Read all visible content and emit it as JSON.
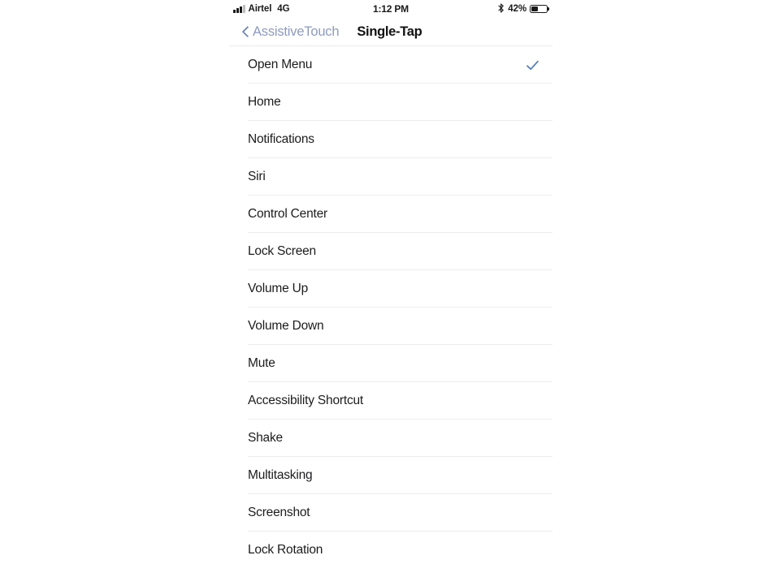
{
  "status_bar": {
    "carrier": "Airtel",
    "network": "4G",
    "time": "1:12 PM",
    "battery_percent": "42%",
    "battery_level": 42,
    "signal_bars_filled": 3,
    "signal_bars_total": 4,
    "bluetooth_icon": "bluetooth-icon",
    "battery_icon": "battery-icon"
  },
  "nav_bar": {
    "back_label": "AssistiveTouch",
    "back_icon": "chevron-left-icon",
    "title": "Single-Tap",
    "back_tint": "#8e9bbd"
  },
  "list": {
    "selected": "Open Menu",
    "checkmark_icon": "checkmark-icon",
    "checkmark_color": "#4d7cb0",
    "rows": [
      {
        "label": "Open Menu",
        "checked": true
      },
      {
        "label": "Home",
        "checked": false
      },
      {
        "label": "Notifications",
        "checked": false
      },
      {
        "label": "Siri",
        "checked": false
      },
      {
        "label": "Control Center",
        "checked": false
      },
      {
        "label": "Lock Screen",
        "checked": false
      },
      {
        "label": "Volume Up",
        "checked": false
      },
      {
        "label": "Volume Down",
        "checked": false
      },
      {
        "label": "Mute",
        "checked": false
      },
      {
        "label": "Accessibility Shortcut",
        "checked": false
      },
      {
        "label": "Shake",
        "checked": false
      },
      {
        "label": "Multitasking",
        "checked": false
      },
      {
        "label": "Screenshot",
        "checked": false
      },
      {
        "label": "Lock Rotation",
        "checked": false
      }
    ]
  }
}
